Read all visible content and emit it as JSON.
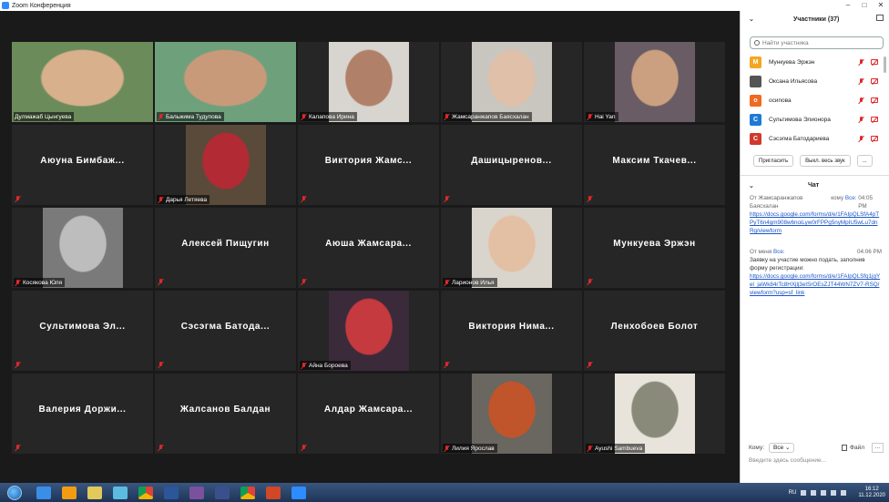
{
  "window": {
    "title": "Zoom Конференция",
    "controls": [
      "–",
      "□",
      "✕"
    ]
  },
  "tiles": [
    {
      "name": "Дулмажаб Цынгуева",
      "video": true,
      "active": true,
      "muted": false
    },
    {
      "name": "Бальжима Тудупова",
      "video": true,
      "muted": true
    },
    {
      "name": "Калапова Ирина",
      "video": true,
      "muted": true
    },
    {
      "name": "Жамсаранжапов Баясхалан",
      "video": true,
      "muted": true
    },
    {
      "name": "Hai Yan",
      "video": true,
      "muted": true
    },
    {
      "name": "Аюуна Бимбаж...",
      "video": false,
      "muted": true
    },
    {
      "name": "Дарья Летяева",
      "video": true,
      "muted": true
    },
    {
      "name": "Виктория Жамс...",
      "video": false,
      "muted": true
    },
    {
      "name": "Дашицыренов...",
      "video": false,
      "muted": true
    },
    {
      "name": "Максим Ткачев...",
      "video": false,
      "muted": true
    },
    {
      "name": "Косякова Юля",
      "video": true,
      "muted": true
    },
    {
      "name": "Алексей Пищугин",
      "video": false,
      "muted": true
    },
    {
      "name": "Аюша Жамсара...",
      "video": false,
      "muted": true
    },
    {
      "name": "Ларионов Илья",
      "video": true,
      "muted": true
    },
    {
      "name": "Мункуева Эржэн",
      "video": false,
      "muted": true
    },
    {
      "name": "Сультимова Эл...",
      "video": false,
      "muted": true
    },
    {
      "name": "Сэсэгма Батода...",
      "video": false,
      "muted": true
    },
    {
      "name": "Айна Бороева",
      "video": true,
      "muted": true
    },
    {
      "name": "Виктория Нима...",
      "video": false,
      "muted": true
    },
    {
      "name": "Ленхобоев Болот",
      "video": false,
      "muted": true
    },
    {
      "name": "Валерия Доржи...",
      "video": false,
      "muted": true
    },
    {
      "name": "Жалсанов Балдан",
      "video": false,
      "muted": true
    },
    {
      "name": "Алдар Жамсара...",
      "video": false,
      "muted": true
    },
    {
      "name": "Лилия Ярослав",
      "video": true,
      "muted": true
    },
    {
      "name": "Ayushi Sambueva",
      "video": true,
      "muted": true
    }
  ],
  "participants": {
    "title": "Участники (37)",
    "search_placeholder": "Найти участника",
    "list": [
      {
        "initial": "М",
        "name": "Мункуева Эржэн",
        "color": "#f5a623"
      },
      {
        "initial": "",
        "name": "Оксана Ильясова",
        "color": "#555555"
      },
      {
        "initial": "о",
        "name": "осипова",
        "color": "#f06a1f"
      },
      {
        "initial": "С",
        "name": "Сультимова Элионора",
        "color": "#1f7ad6"
      },
      {
        "initial": "С",
        "name": "Сэсэгма Батодариева",
        "color": "#d0392c"
      }
    ],
    "invite_label": "Пригласить",
    "mute_all_label": "Выкл. весь звук",
    "more_label": "..."
  },
  "chat": {
    "title": "Чат",
    "messages": [
      {
        "from": "От Жамсаранжапов Баясхалан",
        "to_prefix": "кому",
        "to": "Все:",
        "time": "04:05 PM",
        "text": "",
        "link": "https://docs.google.com/forms/d/e/1FAIpQLSfA4pTPyT6n4gm908w6noiLyw0rFPPg5nyMpIU5wLu7dnRg/viewform"
      },
      {
        "from": "От меня",
        "to_prefix": "",
        "to": "Все:",
        "time": "04:06 PM",
        "text": "Заявку на участие можно подать, заполнив форму регистрации:",
        "link": "https://docs.google.com/forms/d/e/1FAIpQLSfq1jgYel_jaWk84rTc8HXjlj3eISrOEsZJT44WN7ZV7-RSQ/viewform?usp=sf_link"
      }
    ],
    "to_label": "Кому:",
    "to_value": "Все",
    "file_label": "Файл",
    "more_label": "...",
    "compose_placeholder": "Введите здесь сообщение..."
  },
  "taskbar": {
    "lang": "RU",
    "time": "16:12",
    "date": "11.12.2020"
  }
}
